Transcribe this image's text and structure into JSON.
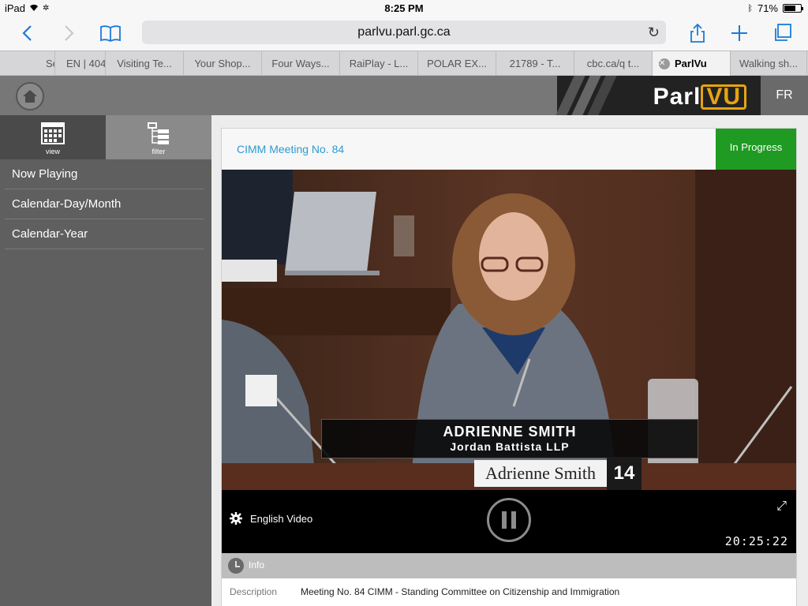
{
  "status_bar": {
    "device": "iPad",
    "time": "8:25 PM",
    "battery_text": "71%",
    "battery_level": 0.71
  },
  "browser": {
    "url": "parlvu.parl.gc.ca",
    "tabs": [
      {
        "label": "Se",
        "active": false
      },
      {
        "label": "EN | 404",
        "active": false
      },
      {
        "label": "Visiting Te...",
        "active": false
      },
      {
        "label": "Your Shop...",
        "active": false
      },
      {
        "label": "Four Ways...",
        "active": false
      },
      {
        "label": "RaiPlay - L...",
        "active": false
      },
      {
        "label": "POLAR EX...",
        "active": false
      },
      {
        "label": "21789 - T...",
        "active": false
      },
      {
        "label": "cbc.ca/q t...",
        "active": false
      },
      {
        "label": "ParlVu",
        "active": true
      },
      {
        "label": "Walking sh...",
        "active": false
      }
    ]
  },
  "header": {
    "logo_part1": "Parl",
    "logo_part2": "VU",
    "language_toggle": "FR",
    "brand_color": "#e6a411"
  },
  "sidebar": {
    "buttons": [
      {
        "label": "view",
        "icon": "calendar-icon"
      },
      {
        "label": "filter",
        "icon": "filter-tree-icon"
      }
    ],
    "items": [
      {
        "label": "Now Playing"
      },
      {
        "label": "Calendar-Day/Month"
      },
      {
        "label": "Calendar-Year"
      }
    ]
  },
  "meeting": {
    "title": "CIMM Meeting No. 84",
    "status": "In Progress",
    "status_color": "#1f9a22"
  },
  "video": {
    "speaker_name": "ADRIENNE SMITH",
    "speaker_org": "Jordan Battista LLP",
    "nameplate": "Adrienne Smith",
    "seat_number": "14",
    "audio_track": "English Video",
    "timecode": "20:25:22"
  },
  "info": {
    "label": "Info",
    "description_key": "Description",
    "description_value": "Meeting No. 84 CIMM - Standing Committee on Citizenship and Immigration"
  }
}
